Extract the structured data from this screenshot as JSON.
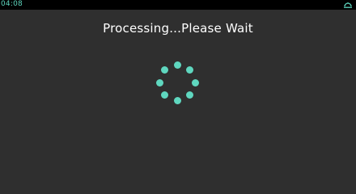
{
  "status_bar": {
    "time": "04:08",
    "icon": "dome-icon"
  },
  "loading": {
    "title": "Processing...Please Wait",
    "spinner_icon": "loading-spinner-icon",
    "dot_count": 8
  },
  "colors": {
    "background": "#2f2f2f",
    "status_bar": "#000000",
    "accent": "#5fd7bf",
    "text": "#ffffff"
  }
}
